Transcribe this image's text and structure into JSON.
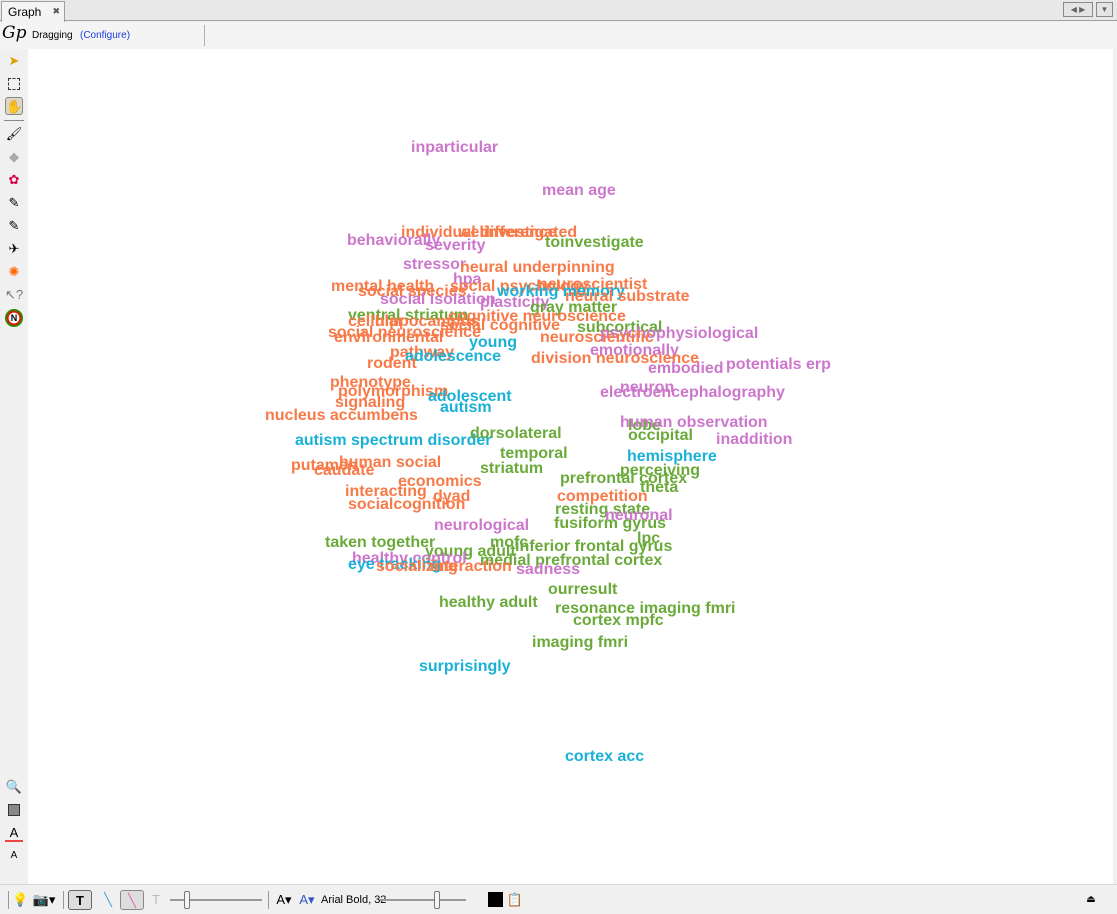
{
  "tab": {
    "title": "Graph",
    "close_icon": "close-icon"
  },
  "toolbar": {
    "mode": "Dragging",
    "configure": "(Configure)"
  },
  "left_tools": [
    "pointer-icon",
    "rectangle-select-icon",
    "hand-drag-icon",
    "brush-icon",
    "diamond-size-icon",
    "color-palette-icon",
    "pencil-icon",
    "edge-pencil-icon",
    "airplane-icon",
    "settings-sun-icon",
    "pointer-help-icon",
    "color-wheel-n-icon",
    "zoom-icon",
    "background-color-icon",
    "font-color-icon",
    "font-size-icon"
  ],
  "bottom": {
    "font": "Arial Bold, 32",
    "color": "#000000"
  },
  "colors": {
    "orange": "#f77a48",
    "purple": "#cc77cc",
    "green": "#6aaa3a",
    "cyan": "#1ab1d6"
  },
  "labels": [
    {
      "t": "inparticular",
      "c": "purple"
    },
    {
      "t": "mean age",
      "c": "purple"
    },
    {
      "t": "individual difference",
      "c": "orange"
    },
    {
      "t": "welinvestigated",
      "c": "orange"
    },
    {
      "t": "behaviorally",
      "c": "purple"
    },
    {
      "t": "severity",
      "c": "purple"
    },
    {
      "t": "toinvestigate",
      "c": "green"
    },
    {
      "t": "stressor",
      "c": "purple"
    },
    {
      "t": "neural underpinning",
      "c": "orange"
    },
    {
      "t": "hpa",
      "c": "purple"
    },
    {
      "t": "mental health",
      "c": "orange"
    },
    {
      "t": "social psychology",
      "c": "orange"
    },
    {
      "t": "neuroscientist",
      "c": "orange"
    },
    {
      "t": "social species",
      "c": "orange"
    },
    {
      "t": "working memory",
      "c": "cyan"
    },
    {
      "t": "social isolation",
      "c": "purple"
    },
    {
      "t": "neural substrate",
      "c": "orange"
    },
    {
      "t": "plasticity",
      "c": "purple"
    },
    {
      "t": "gray matter",
      "c": "green"
    },
    {
      "t": "ventral striatum",
      "c": "green"
    },
    {
      "t": "cognitive neuroscience",
      "c": "orange"
    },
    {
      "t": "cellular",
      "c": "orange"
    },
    {
      "t": "hippocampus",
      "c": "orange"
    },
    {
      "t": "social cognitive",
      "c": "orange"
    },
    {
      "t": "subcortical",
      "c": "green"
    },
    {
      "t": "psychophysiological",
      "c": "purple"
    },
    {
      "t": "social neuroscience",
      "c": "orange"
    },
    {
      "t": "environmental",
      "c": "orange"
    },
    {
      "t": "neuroscientific",
      "c": "orange"
    },
    {
      "t": "young",
      "c": "cyan"
    },
    {
      "t": "pathway",
      "c": "orange"
    },
    {
      "t": "adolescence",
      "c": "cyan"
    },
    {
      "t": "emotionally",
      "c": "purple"
    },
    {
      "t": "division neuroscience",
      "c": "orange"
    },
    {
      "t": "potentials erp",
      "c": "purple"
    },
    {
      "t": "rodent",
      "c": "orange"
    },
    {
      "t": "embodied",
      "c": "purple"
    },
    {
      "t": "electroencephalography",
      "c": "purple"
    },
    {
      "t": "phenotype",
      "c": "orange"
    },
    {
      "t": "polymorphism",
      "c": "orange"
    },
    {
      "t": "neuron",
      "c": "purple"
    },
    {
      "t": "adolescent",
      "c": "cyan"
    },
    {
      "t": "signaling",
      "c": "orange"
    },
    {
      "t": "nucleus accumbens",
      "c": "orange"
    },
    {
      "t": "autism",
      "c": "cyan"
    },
    {
      "t": "lobe",
      "c": "green"
    },
    {
      "t": "human observation",
      "c": "purple"
    },
    {
      "t": "inaddition",
      "c": "purple"
    },
    {
      "t": "occipital",
      "c": "green"
    },
    {
      "t": "autism spectrum disorder",
      "c": "cyan"
    },
    {
      "t": "hemisphere",
      "c": "cyan"
    },
    {
      "t": "putamen",
      "c": "orange"
    },
    {
      "t": "human social",
      "c": "orange"
    },
    {
      "t": "caudate",
      "c": "orange"
    },
    {
      "t": "perceiving",
      "c": "green"
    },
    {
      "t": "prefrontal cortex",
      "c": "green"
    },
    {
      "t": "economics",
      "c": "orange"
    },
    {
      "t": "interacting",
      "c": "orange"
    },
    {
      "t": "theta",
      "c": "green"
    },
    {
      "t": "competition",
      "c": "orange"
    },
    {
      "t": "socialcognition",
      "c": "orange"
    },
    {
      "t": "dyad",
      "c": "orange"
    },
    {
      "t": "resting state",
      "c": "green"
    },
    {
      "t": "neuronal",
      "c": "purple"
    },
    {
      "t": "neurological",
      "c": "purple"
    },
    {
      "t": "fusiform gyrus",
      "c": "green"
    },
    {
      "t": "lpc",
      "c": "green"
    },
    {
      "t": "taken together",
      "c": "green"
    },
    {
      "t": "mofc",
      "c": "green"
    },
    {
      "t": "inferior frontal gyrus",
      "c": "green"
    },
    {
      "t": "young adult",
      "c": "green"
    },
    {
      "t": "medial prefrontal cortex",
      "c": "green"
    },
    {
      "t": "healthy control",
      "c": "purple"
    },
    {
      "t": "eye tracking",
      "c": "cyan"
    },
    {
      "t": "socializing",
      "c": "orange"
    },
    {
      "t": "interaction",
      "c": "orange"
    },
    {
      "t": "sadness",
      "c": "purple"
    },
    {
      "t": "ourresult",
      "c": "green"
    },
    {
      "t": "healthy adult",
      "c": "green"
    },
    {
      "t": "resonance imaging fmri",
      "c": "green"
    },
    {
      "t": "cortex mpfc",
      "c": "green"
    },
    {
      "t": "imaging fmri",
      "c": "green"
    },
    {
      "t": "surprisingly",
      "c": "cyan"
    },
    {
      "t": "cortex acc",
      "c": "cyan"
    },
    {
      "t": "striatum",
      "c": "green"
    },
    {
      "t": "temporal",
      "c": "green"
    },
    {
      "t": "dorsolateral",
      "c": "green"
    }
  ]
}
